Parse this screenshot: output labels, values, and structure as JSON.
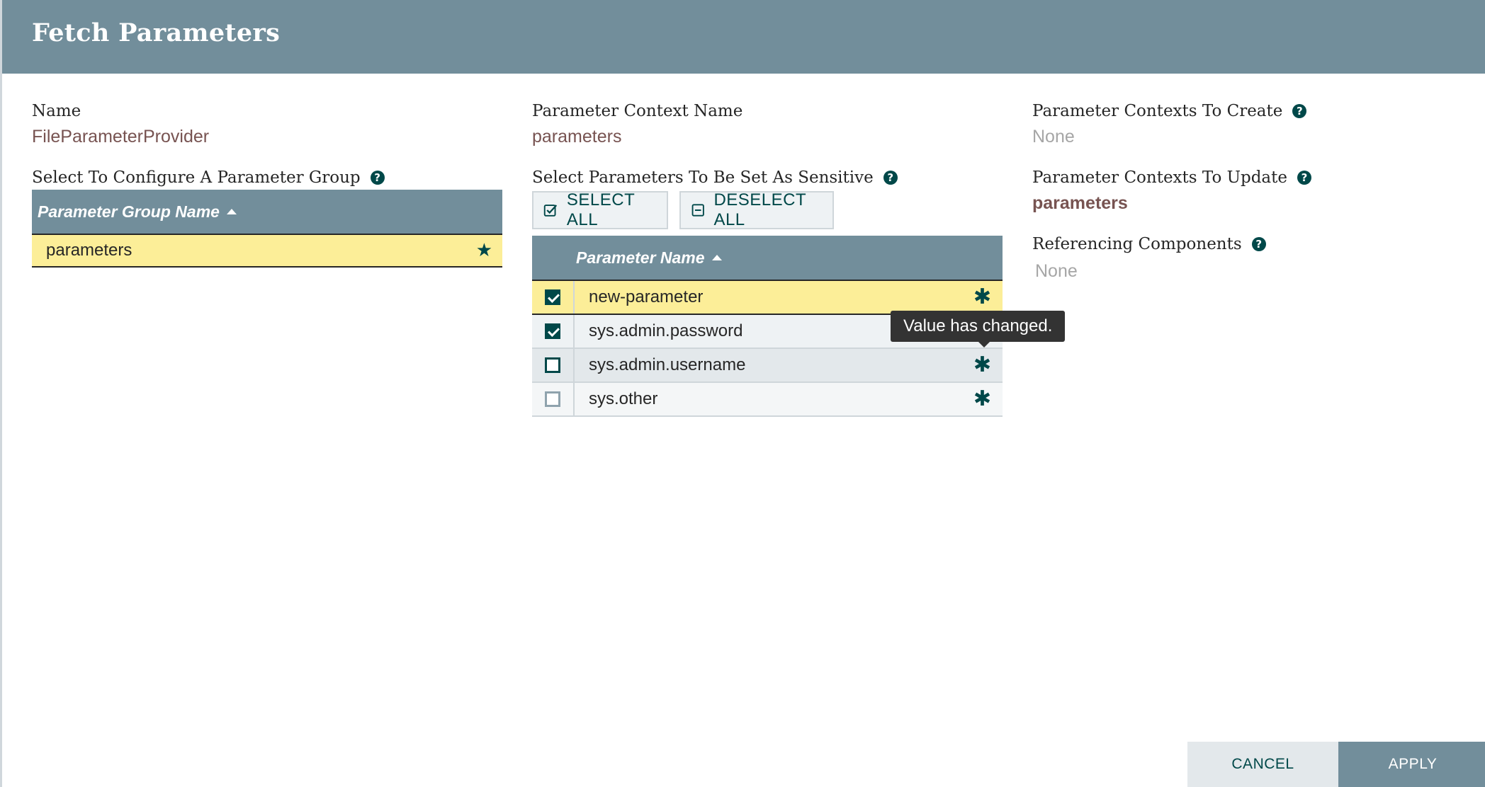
{
  "dialog": {
    "title": "Fetch Parameters"
  },
  "left": {
    "name_label": "Name",
    "name_value": "FileParameterProvider",
    "group_label": "Select To Configure A Parameter Group",
    "grid": {
      "header": "Parameter Group Name",
      "rows": [
        {
          "name": "parameters",
          "icon": "star-icon"
        }
      ]
    }
  },
  "middle": {
    "context_label": "Parameter Context Name",
    "context_value": "parameters",
    "sensitive_label": "Select Parameters To Be Set As Sensitive",
    "select_all": "SELECT ALL",
    "deselect_all": "DESELECT ALL",
    "grid": {
      "header": "Parameter Name",
      "rows": [
        {
          "name": "new-parameter",
          "checked": true,
          "changed": true
        },
        {
          "name": "sys.admin.password",
          "checked": true,
          "changed": false
        },
        {
          "name": "sys.admin.username",
          "checked": false,
          "changed": true
        },
        {
          "name": "sys.other",
          "checked": false,
          "changed": true
        }
      ]
    },
    "tooltip": "Value has changed."
  },
  "right": {
    "create_label": "Parameter Contexts To Create",
    "create_value": "None",
    "update_label": "Parameter Contexts To Update",
    "update_value": "parameters",
    "referencing_label": "Referencing Components",
    "referencing_value": "None"
  },
  "footer": {
    "cancel": "CANCEL",
    "apply": "APPLY"
  },
  "colors": {
    "header": "#728e9b",
    "accent": "#004849",
    "selected_row": "#fcee98",
    "value_text": "#775351"
  }
}
